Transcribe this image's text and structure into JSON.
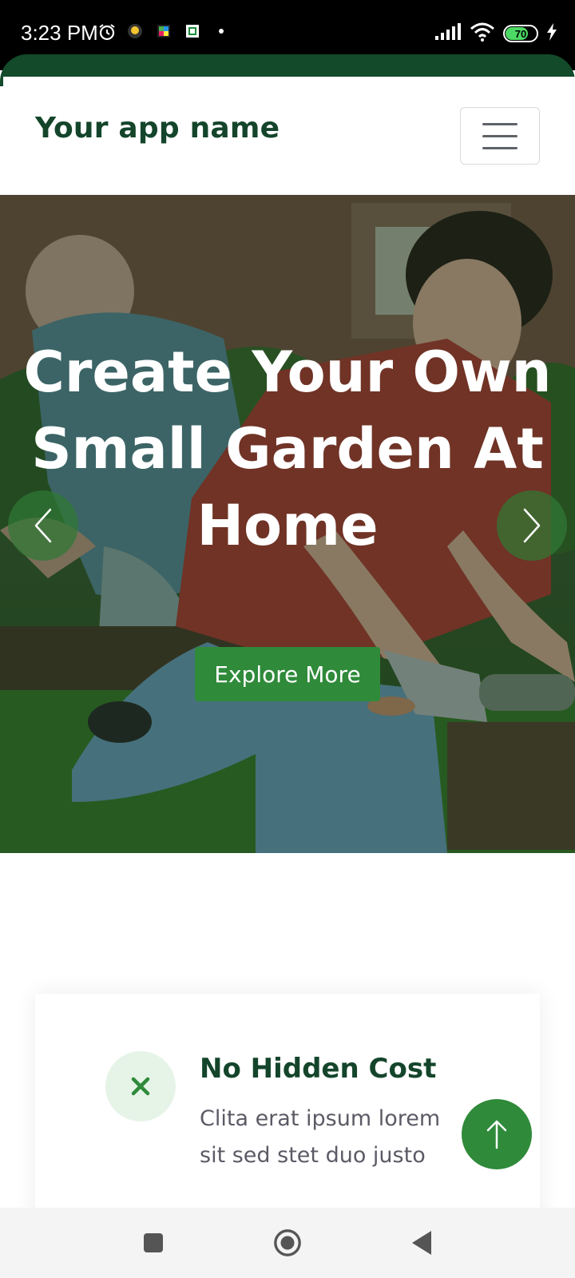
{
  "status_bar": {
    "time": "3:23 PM",
    "battery_level": "70",
    "battery_fraction": 0.7,
    "icons": [
      "alarm-icon",
      "notification-app-icon",
      "notification-app-icon",
      "notification-app-icon",
      "more-notifications-dot",
      "signal-icon",
      "wifi-icon",
      "battery-icon",
      "charging-icon"
    ]
  },
  "navbar": {
    "brand": "Your app name",
    "menu_icon": "hamburger-menu-icon"
  },
  "hero": {
    "title": "Create Your Own Small Garden At Home",
    "cta_label": "Explore More",
    "prev_icon": "chevron-left-icon",
    "next_icon": "chevron-right-icon"
  },
  "feature": {
    "icon": "close-x-icon",
    "title": "No Hidden Cost",
    "description": "Clita erat ipsum lorem sit sed stet duo justo"
  },
  "back_to_top_icon": "arrow-up-icon",
  "system_nav": {
    "recent_icon": "recent-apps-icon",
    "home_icon": "home-circle-icon",
    "back_icon": "back-triangle-icon"
  },
  "colors": {
    "brand_dark_green": "#14452b",
    "accent_green": "#2f8a3a",
    "light_green": "#e6f4e8",
    "status_bar": "#000000"
  }
}
